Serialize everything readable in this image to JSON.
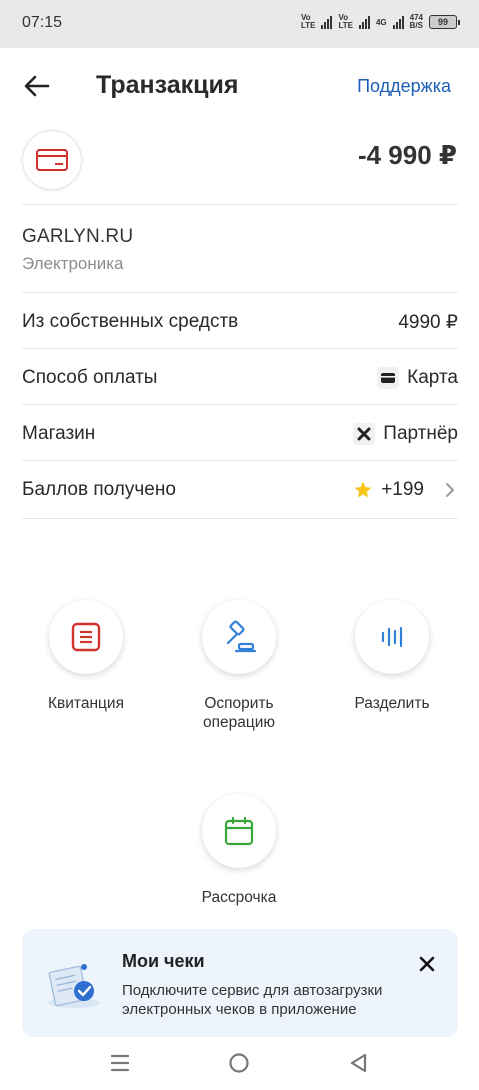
{
  "status_bar": {
    "time": "07:15",
    "volte1": [
      "Vo",
      "LTE"
    ],
    "volte2": [
      "Vo",
      "LTE"
    ],
    "network": "4G",
    "speed_value": "474",
    "speed_unit": "B/S",
    "battery": "99"
  },
  "header": {
    "title": "Транзакция",
    "support_label": "Поддержка",
    "back_icon": "arrow-left-icon"
  },
  "transaction": {
    "amount": "-4 990 ₽",
    "icon": "card-icon",
    "merchant_name": "GARLYN.RU",
    "merchant_category": "Электроника"
  },
  "details": [
    {
      "label": "Из собственных средств",
      "value": "4990 ₽",
      "icon": ""
    },
    {
      "label": "Способ оплаты",
      "value": "Карта",
      "icon": "card-small-icon"
    },
    {
      "label": "Магазин",
      "value": "Партнёр",
      "icon": "partner-icon"
    },
    {
      "label": "Баллов получено",
      "value": "+199",
      "icon": "star-icon"
    }
  ],
  "actions": [
    {
      "label": "Квитанция",
      "icon": "receipt-icon"
    },
    {
      "label": "Оспорить операцию",
      "label_line1": "Оспорить",
      "label_line2": "операцию",
      "icon": "gavel-icon"
    },
    {
      "label": "Разделить",
      "icon": "split-icon"
    },
    {
      "label": "Рассрочка",
      "icon": "calendar-icon"
    }
  ],
  "banner": {
    "title": "Мои чеки",
    "text": "Подключите сервис для автозагрузки электронных чеков в приложение"
  },
  "colors": {
    "accent": "#1b5fb8",
    "red": "#d0342c",
    "green": "#3aa63a",
    "banner_bg": "#eef4fb",
    "star": "#f5c518"
  }
}
